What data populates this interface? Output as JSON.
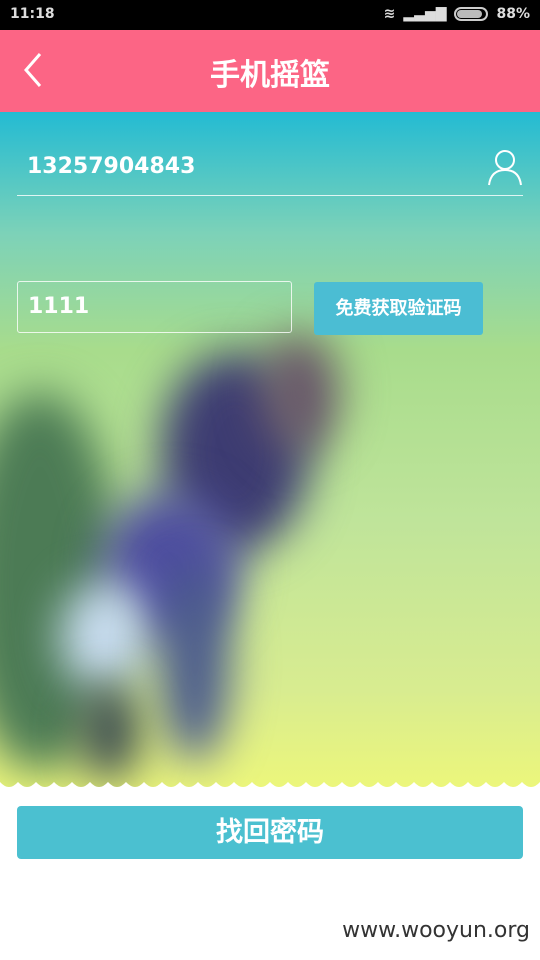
{
  "status_bar": {
    "time": "11:18",
    "battery": "88%",
    "battery_level": 0.88
  },
  "header": {
    "title": "手机摇篮"
  },
  "form": {
    "phone_value": "13257904843",
    "code_value": "1111",
    "get_code_label": "免费获取验证码"
  },
  "submit_label": "找回密码",
  "watermark": "www.wooyun.org",
  "colors": {
    "header": "#fc6585",
    "button": "#4bc0d0"
  }
}
